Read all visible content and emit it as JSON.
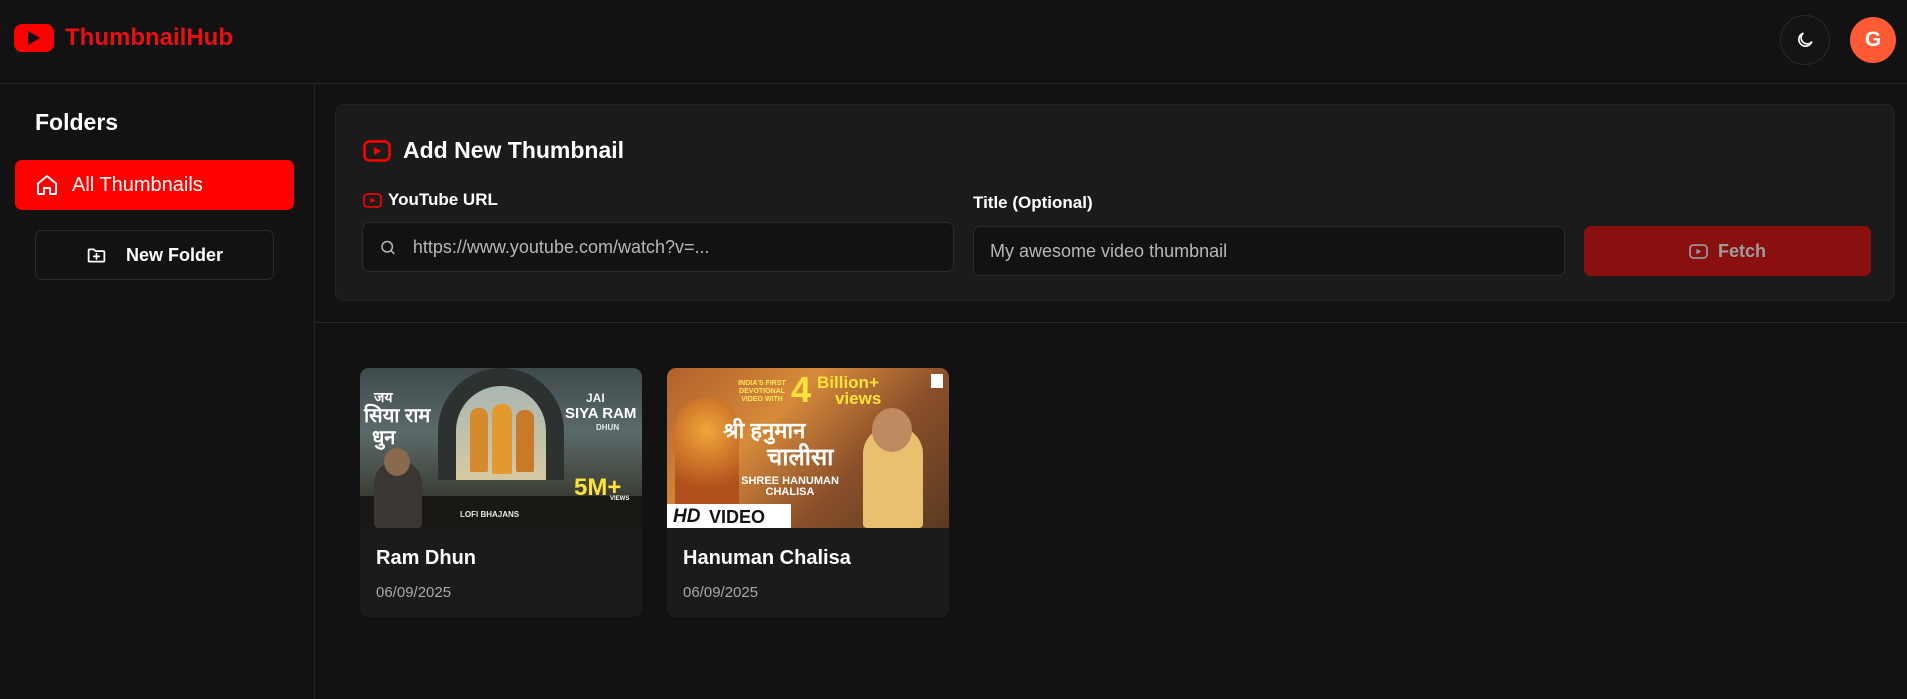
{
  "app": {
    "name": "ThumbnailHub"
  },
  "header": {
    "avatar_initial": "G"
  },
  "sidebar": {
    "title": "Folders",
    "all_label": "All Thumbnails",
    "new_folder_label": "New Folder"
  },
  "add": {
    "title": "Add New Thumbnail",
    "url_label": "YouTube URL",
    "url_placeholder": "https://www.youtube.com/watch?v=...",
    "title_label": "Title (Optional)",
    "title_placeholder": "My awesome video thumbnail",
    "fetch_label": "Fetch"
  },
  "thumbnails": [
    {
      "title": "Ram Dhun",
      "date": "06/09/2025",
      "overlay": {
        "left_top": "जय",
        "left_mid": "सिया राम",
        "left_bottom": "धुन",
        "right_top": "JAI",
        "right_mid": "SIYA RAM",
        "right_small": "DHUN",
        "views": "5M+",
        "views_small": "VIEWS",
        "footer": "LOFI BHAJANS"
      }
    },
    {
      "title": "Hanuman Chalisa",
      "date": "06/09/2025",
      "overlay": {
        "promo": "INDIA'S FIRST DEVOTIONAL VIDEO WITH",
        "big_num": "4",
        "billion": "Billion+",
        "views": "views",
        "hindi_top": "श्री हनुमान",
        "hindi_bottom": "चालीसा",
        "eng": "SHREE HANUMAN CHALISA",
        "hd": "HD",
        "video": "VIDEO"
      }
    }
  ],
  "colors": {
    "accent": "#ff0000",
    "brand_text": "#e81010",
    "avatar": "#ff5a36",
    "fetch_disabled": "#8a0f0f"
  }
}
